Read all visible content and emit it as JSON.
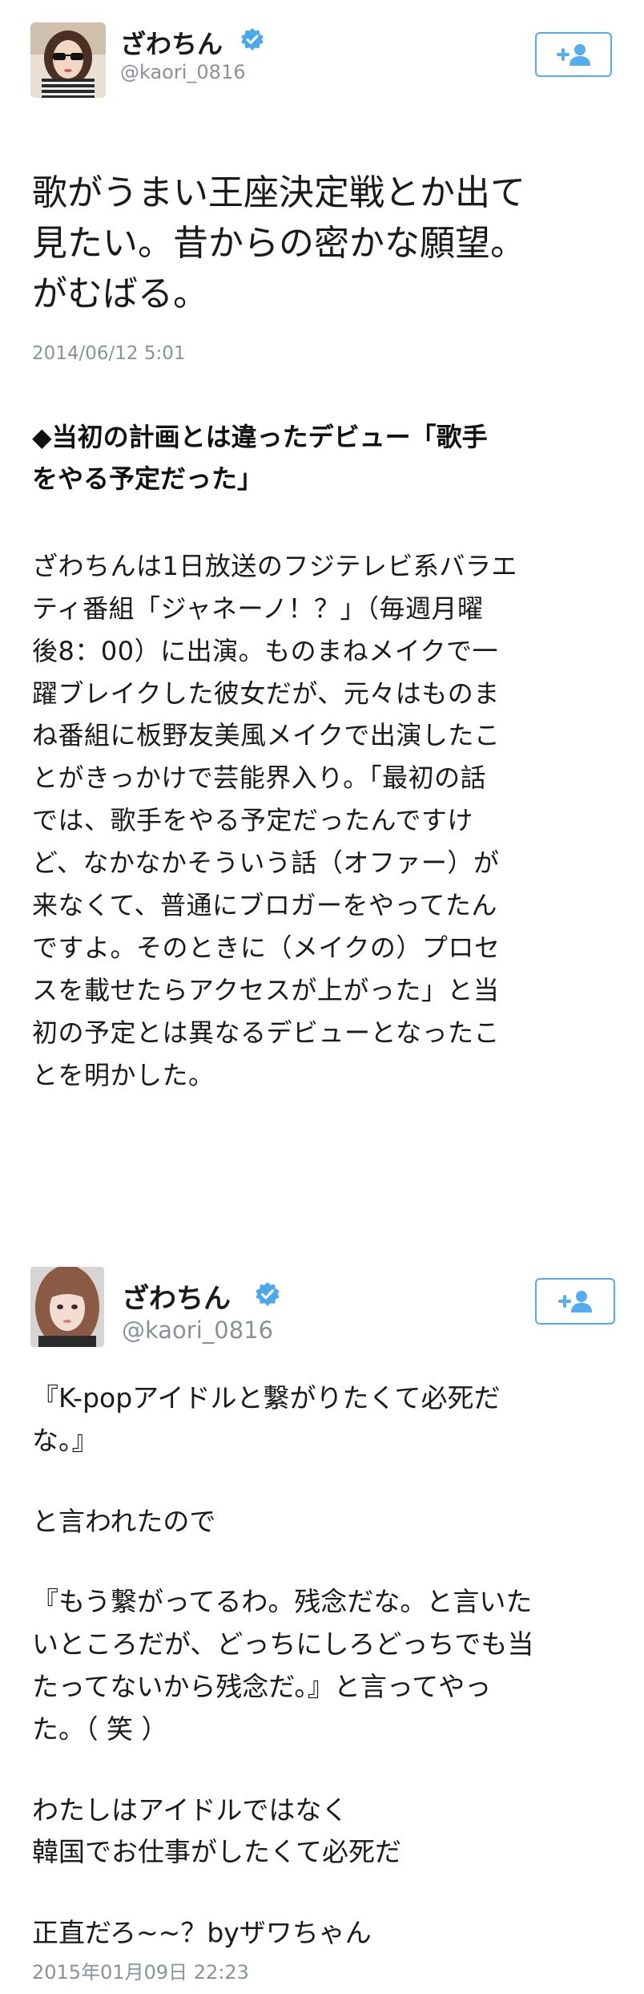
{
  "tweet1": {
    "name": "ざわちん",
    "handle": "@kaori_0816",
    "follow_icon": "follow-plus-user-icon",
    "verified_icon": "verified-badge-icon",
    "text_lines": [
      "歌がうまい王座決定戦とか出て",
      "見たい。昔からの密かな願望。",
      "がむばる。"
    ],
    "date": "2014/06/12 5:01"
  },
  "article": {
    "heading_lines": [
      "◆当初の計画とは違ったデビュー「歌手",
      "をやる予定だった」"
    ],
    "body_lines": [
      "ざわちんは1日放送のフジテレビ系バラエ",
      "ティ番組「ジャネーノ！？」（毎週月曜",
      "後8：00）に出演。ものまねメイクで一",
      "躍ブレイクした彼女だが、元々はものま",
      "ね番組に板野友美風メイクで出演したこ",
      "とがきっかけで芸能界入り。「最初の話",
      "では、歌手をやる予定だったんですけ",
      "ど、なかなかそういう話（オファー）が",
      "来なくて、普通にブロガーをやってたん",
      "ですよ。そのときに（メイクの）プロセ",
      "スを載せたらアクセスが上がった」と当",
      "初の予定とは異なるデビューとなったこ",
      "とを明かした。"
    ]
  },
  "tweet2": {
    "name": "ざわちん",
    "handle": "@kaori_0816",
    "follow_icon": "follow-plus-user-icon",
    "verified_icon": "verified-badge-icon",
    "paragraphs": [
      [
        "『K-popアイドルと繋がりたくて必死だ",
        "な。』"
      ],
      [
        "と言われたので"
      ],
      [
        "『もう繋がってるわ。残念だな。と言いた",
        "いところだが、どっちにしろどっちでも当",
        "たってないから残念だ。』と言ってやっ",
        "た。（ 笑 ）"
      ],
      [
        "わたしはアイドルではなく",
        "韓国でお仕事がしたくて必死だ"
      ],
      [
        "正直だろ~~？byザワちゃん"
      ]
    ],
    "date": "2015年01月09日 22:23"
  },
  "colors": {
    "accent": "#55acee",
    "verified": "#4ca8e8",
    "muted": "#8a9199",
    "text": "#1a1a1a"
  }
}
